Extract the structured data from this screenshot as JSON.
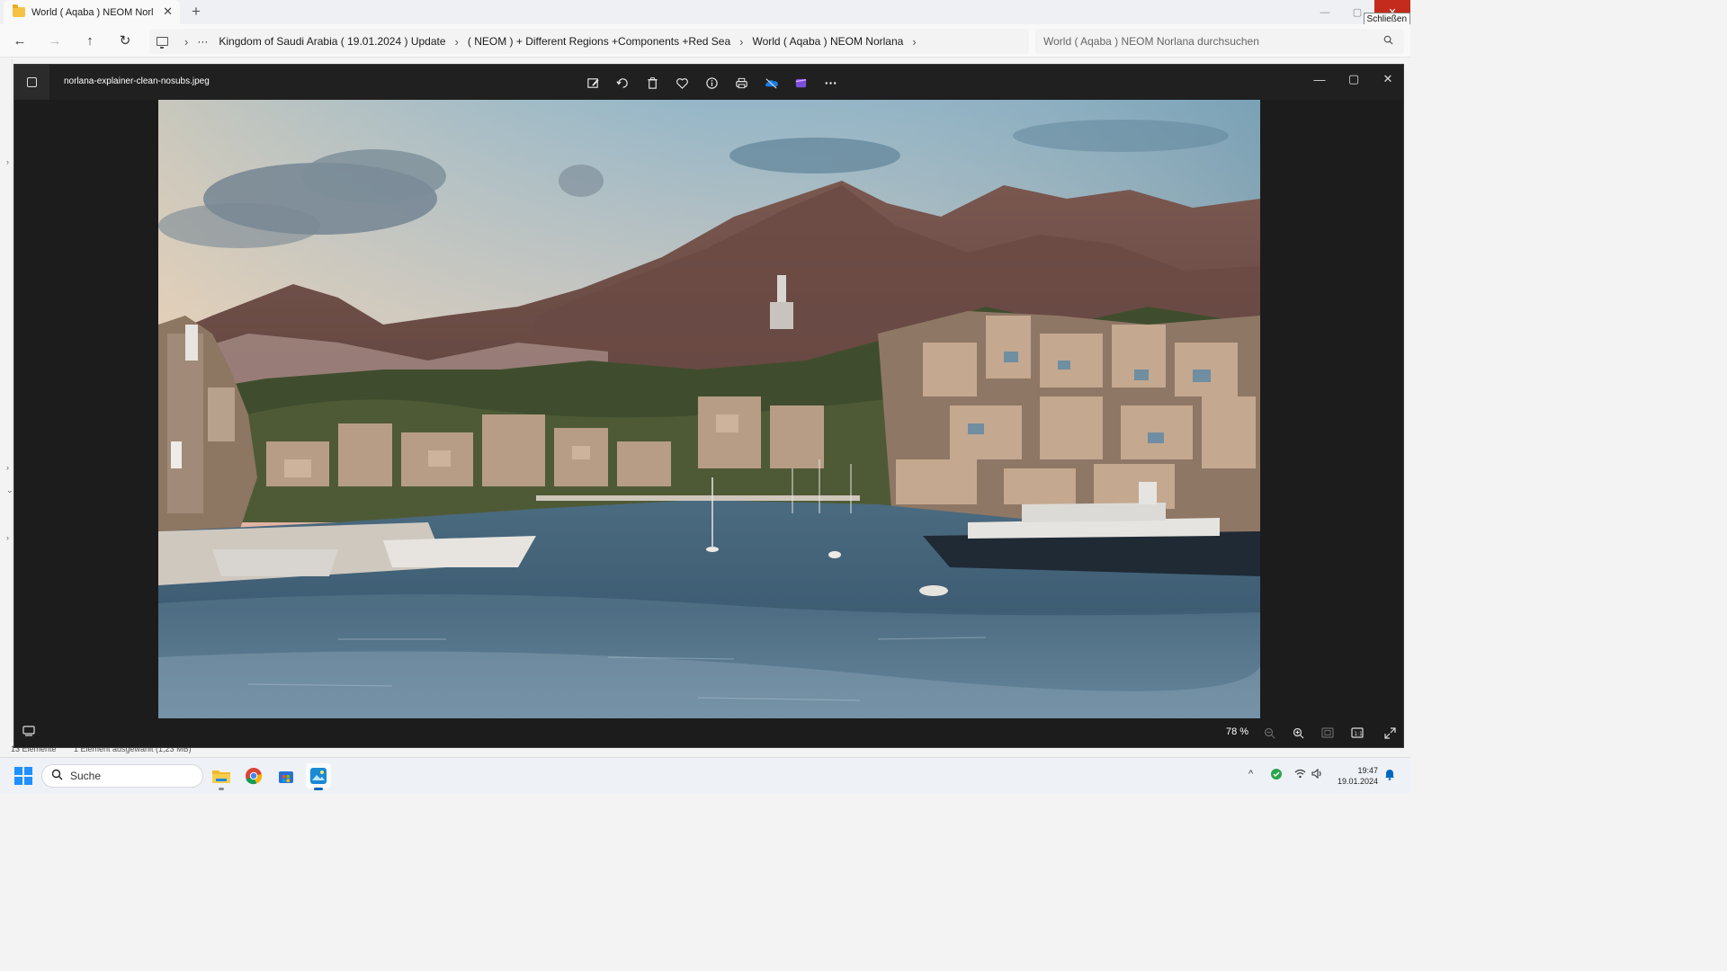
{
  "explorer": {
    "tab": {
      "title": "World ( Aqaba ) NEOM Norlan",
      "close_icon": "close-icon"
    },
    "new_tab": "+",
    "window_controls": {
      "minimize": "—",
      "maximize": "▢",
      "close": "✕",
      "close_tooltip": "Schließen"
    },
    "nav": {
      "back": "←",
      "forward": "→",
      "up": "↑",
      "refresh": "↻"
    },
    "breadcrumbs": [
      "Kingdom of Saudi Arabia ( 19.01.2024 ) Update",
      "( NEOM ) + Different Regions +Components +Red Sea",
      "World ( Aqaba ) NEOM Norlana"
    ],
    "more": "···",
    "search_placeholder": "World ( Aqaba ) NEOM Norlana durchsuchen",
    "status": {
      "items": "13 Elemente",
      "selected": "1 Element ausgewählt (1,23 MB)"
    }
  },
  "viewer": {
    "filename": "norlana-explainer-clean-nosubs.jpeg",
    "toolbar": [
      "edit-icon",
      "rotate-icon",
      "delete-icon",
      "favorite-icon",
      "info-icon",
      "print-icon",
      "onedrive-icon",
      "clipchamp-icon",
      "more-icon"
    ],
    "zoom": "78 %",
    "window_controls": {
      "minimize": "—",
      "maximize": "▢",
      "close": "✕"
    }
  },
  "taskbar": {
    "search_label": "Suche",
    "apps": [
      "file-explorer-icon",
      "chrome-icon",
      "store-icon",
      "photos-icon"
    ],
    "time": "19:47",
    "date": "19.01.2024"
  },
  "colors": {
    "accent": "#0067c0",
    "close_red": "#c42b1c",
    "viewer_bg": "#1c1c1c"
  }
}
